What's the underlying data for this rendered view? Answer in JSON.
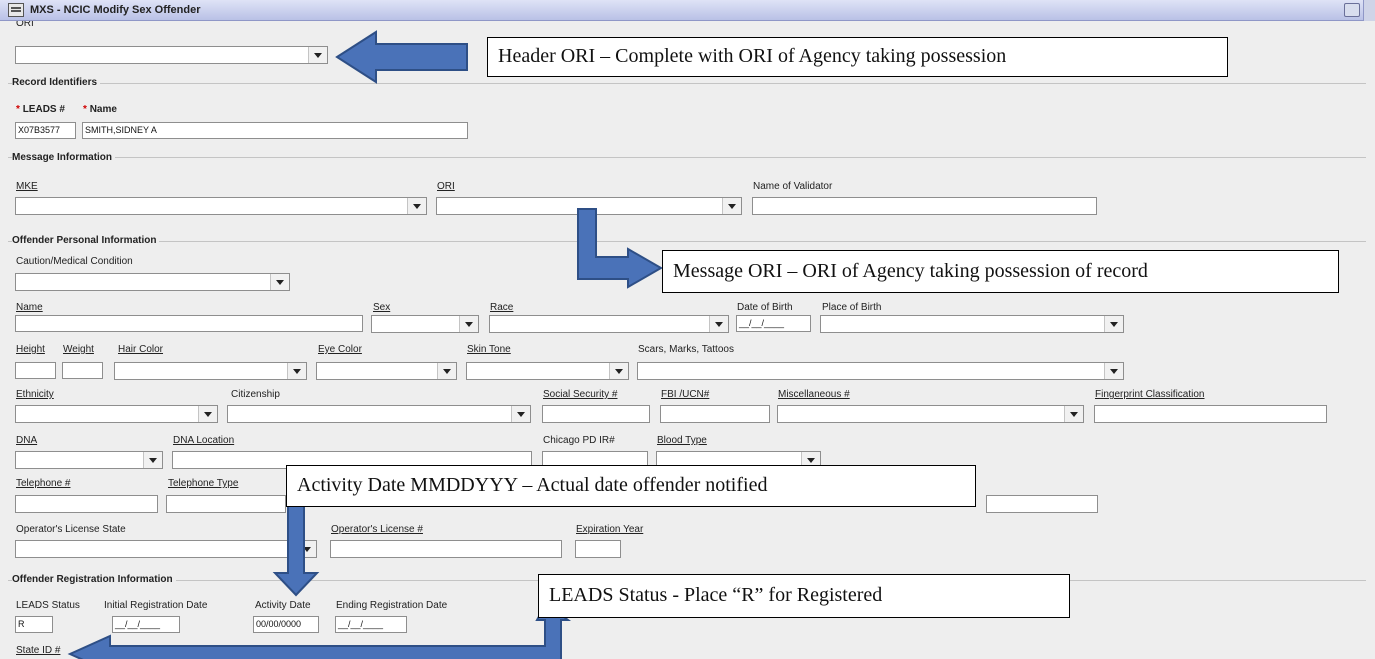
{
  "window": {
    "title": "MXS - NCIC Modify Sex Offender"
  },
  "header": {
    "ori_label": "ORI"
  },
  "record_identifiers": {
    "section": "Record Identifiers",
    "required_mark": "*",
    "leads_label": "LEADS #",
    "leads_value": "X07B3577",
    "name_label": "Name",
    "name_value": "SMITH,SIDNEY A"
  },
  "message_info": {
    "section": "Message Information",
    "mke_label": "MKE",
    "ori_label": "ORI",
    "validator_label": "Name of Validator"
  },
  "offender_info": {
    "section": "Offender Personal Information",
    "caution_label": "Caution/Medical Condition",
    "name_label": "Name",
    "sex_label": "Sex",
    "race_label": "Race",
    "dob_label": "Date of Birth",
    "dob_value": "__/__/____",
    "pob_label": "Place of Birth",
    "height_label": "Height",
    "weight_label": "Weight",
    "hair_label": "Hair Color",
    "eye_label": "Eye Color",
    "skin_label": "Skin Tone",
    "scars_label": "Scars, Marks, Tattoos",
    "ethnicity_label": "Ethnicity",
    "citizenship_label": "Citizenship",
    "ssn_label": "Social Security #",
    "fbi_label": "FBI /UCN#",
    "misc_label": "Miscellaneous #",
    "fingerprint_label": "Fingerprint Classification",
    "dna_label": "DNA",
    "dna_location_label": "DNA Location",
    "chicago_label": "Chicago PD IR#",
    "blood_label": "Blood Type",
    "phone_label": "Telephone #",
    "phone_type_label": "Telephone Type",
    "ol_state_label": "Operator's License State",
    "ol_number_label": "Operator's License #",
    "exp_label": "Expiration Year"
  },
  "registration": {
    "section": "Offender Registration Information",
    "status_label": "LEADS Status",
    "status_value": "R",
    "initial_label": "Initial Registration Date",
    "initial_value": "__/__/____",
    "activity_label": "Activity Date",
    "activity_value": "00/00/0000",
    "ending_label": "Ending Registration Date",
    "ending_value": "__/__/____",
    "state_id_label": "State ID #"
  },
  "callouts": {
    "header_ori": "Header ORI – Complete with ORI of Agency taking possession",
    "message_ori": "Message ORI – ORI of Agency taking possession of record",
    "activity_date": "Activity Date MMDDYYY – Actual date offender notified",
    "leads_status": "LEADS Status  - Place “R” for Registered"
  },
  "colors": {
    "arrow_fill": "#4a72b8",
    "arrow_stroke": "#2e4f86",
    "required": "#d00000"
  }
}
